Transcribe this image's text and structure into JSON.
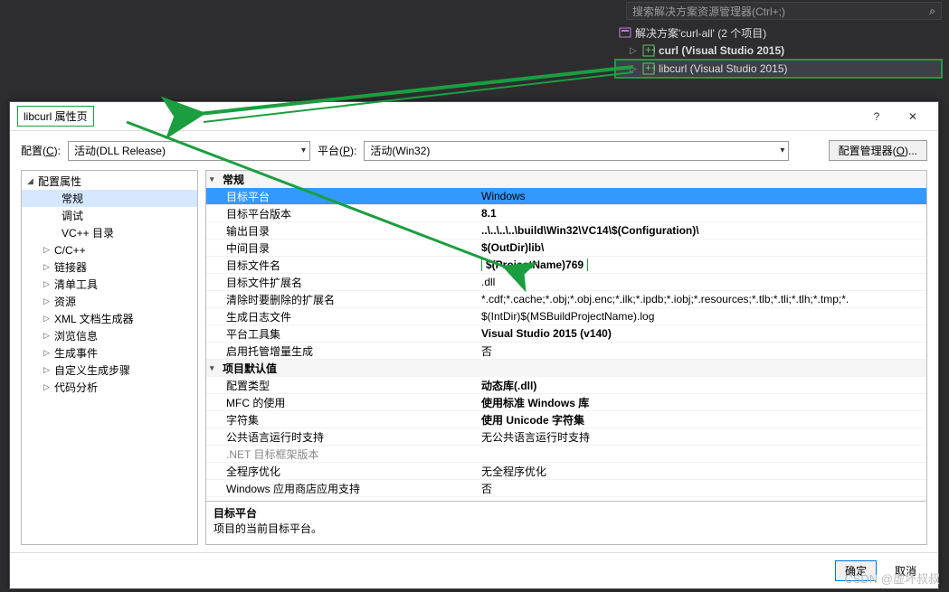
{
  "search": {
    "placeholder": "搜索解决方案资源管理器(Ctrl+;)"
  },
  "solution": {
    "root": "解决方案'curl-all' (2 个项目)",
    "proj1": "curl (Visual Studio 2015)",
    "proj2": "libcurl (Visual Studio 2015)"
  },
  "dialog": {
    "title": "libcurl 属性页",
    "helpGlyph": "?",
    "closeGlyph": "✕",
    "configLabelPre": "配置(",
    "configLabelKey": "C",
    "configLabelPost": "):",
    "configValue": "活动(DLL Release)",
    "platformLabelPre": "平台(",
    "platformLabelKey": "P",
    "platformLabelPost": "):",
    "platformValue": "活动(Win32)",
    "mgrLabelPre": "配置管理器(",
    "mgrLabelKey": "O",
    "mgrLabelPost": ")...",
    "ok": "确定",
    "cancel": "取消"
  },
  "tree": {
    "root": "配置属性",
    "items": [
      "常规",
      "调试",
      "VC++ 目录",
      "C/C++",
      "链接器",
      "清单工具",
      "资源",
      "XML 文档生成器",
      "浏览信息",
      "生成事件",
      "自定义生成步骤",
      "代码分析"
    ],
    "expandable": [
      false,
      false,
      false,
      true,
      true,
      true,
      true,
      true,
      true,
      true,
      true,
      true
    ],
    "selectedIndex": 0
  },
  "groups": {
    "g1": "常规",
    "g2": "项目默认值"
  },
  "props": [
    {
      "name": "目标平台",
      "value": "Windows",
      "bold": false,
      "sel": true
    },
    {
      "name": "目标平台版本",
      "value": "8.1",
      "bold": true
    },
    {
      "name": "输出目录",
      "value": "..\\..\\..\\..\\build\\Win32\\VC14\\$(Configuration)\\",
      "bold": true
    },
    {
      "name": "中间目录",
      "value": "$(OutDir)lib\\",
      "bold": true
    },
    {
      "name": "目标文件名",
      "value": "$(ProjectName)769",
      "bold": true,
      "box": true
    },
    {
      "name": "目标文件扩展名",
      "value": ".dll",
      "bold": false
    },
    {
      "name": "清除时要删除的扩展名",
      "value": "*.cdf;*.cache;*.obj;*.obj.enc;*.ilk;*.ipdb;*.iobj;*.resources;*.tlb;*.tli;*.tlh;*.tmp;*.",
      "bold": false
    },
    {
      "name": "生成日志文件",
      "value": "$(IntDir)$(MSBuildProjectName).log",
      "bold": false
    },
    {
      "name": "平台工具集",
      "value": "Visual Studio 2015 (v140)",
      "bold": true
    },
    {
      "name": "启用托管增量生成",
      "value": "否",
      "bold": false
    }
  ],
  "props2": [
    {
      "name": "配置类型",
      "value": "动态库(.dll)",
      "bold": true
    },
    {
      "name": "MFC 的使用",
      "value": "使用标准 Windows 库",
      "bold": true
    },
    {
      "name": "字符集",
      "value": "使用 Unicode 字符集",
      "bold": true
    },
    {
      "name": "公共语言运行时支持",
      "value": "无公共语言运行时支持",
      "bold": false
    },
    {
      "name": ".NET 目标框架版本",
      "value": "",
      "bold": false,
      "grey": true
    },
    {
      "name": "全程序优化",
      "value": "无全程序优化",
      "bold": false
    },
    {
      "name": "Windows 应用商店应用支持",
      "value": "否",
      "bold": false
    }
  ],
  "desc": {
    "title": "目标平台",
    "body": "项目的当前目标平台。"
  },
  "watermark": "CSDN @虚坏叔叔"
}
